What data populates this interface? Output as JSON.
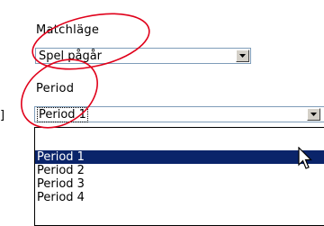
{
  "form": {
    "matchlage_label": "Matchläge",
    "matchlage_value": "Spel pågår",
    "period_label": "Period",
    "period_value": "Period 1",
    "left_fragment": "]"
  },
  "period_options": [
    "",
    "Period 1",
    "Period 2",
    "Period 3",
    "Period 4"
  ],
  "selected_option_index": 1,
  "colors": {
    "annotation": "#e0001a",
    "selection": "#0a246a",
    "field_border": "#7f9db9",
    "button_face": "#d4d0c8"
  },
  "icons": [
    "chevron-down-icon",
    "mouse-pointer-icon"
  ]
}
